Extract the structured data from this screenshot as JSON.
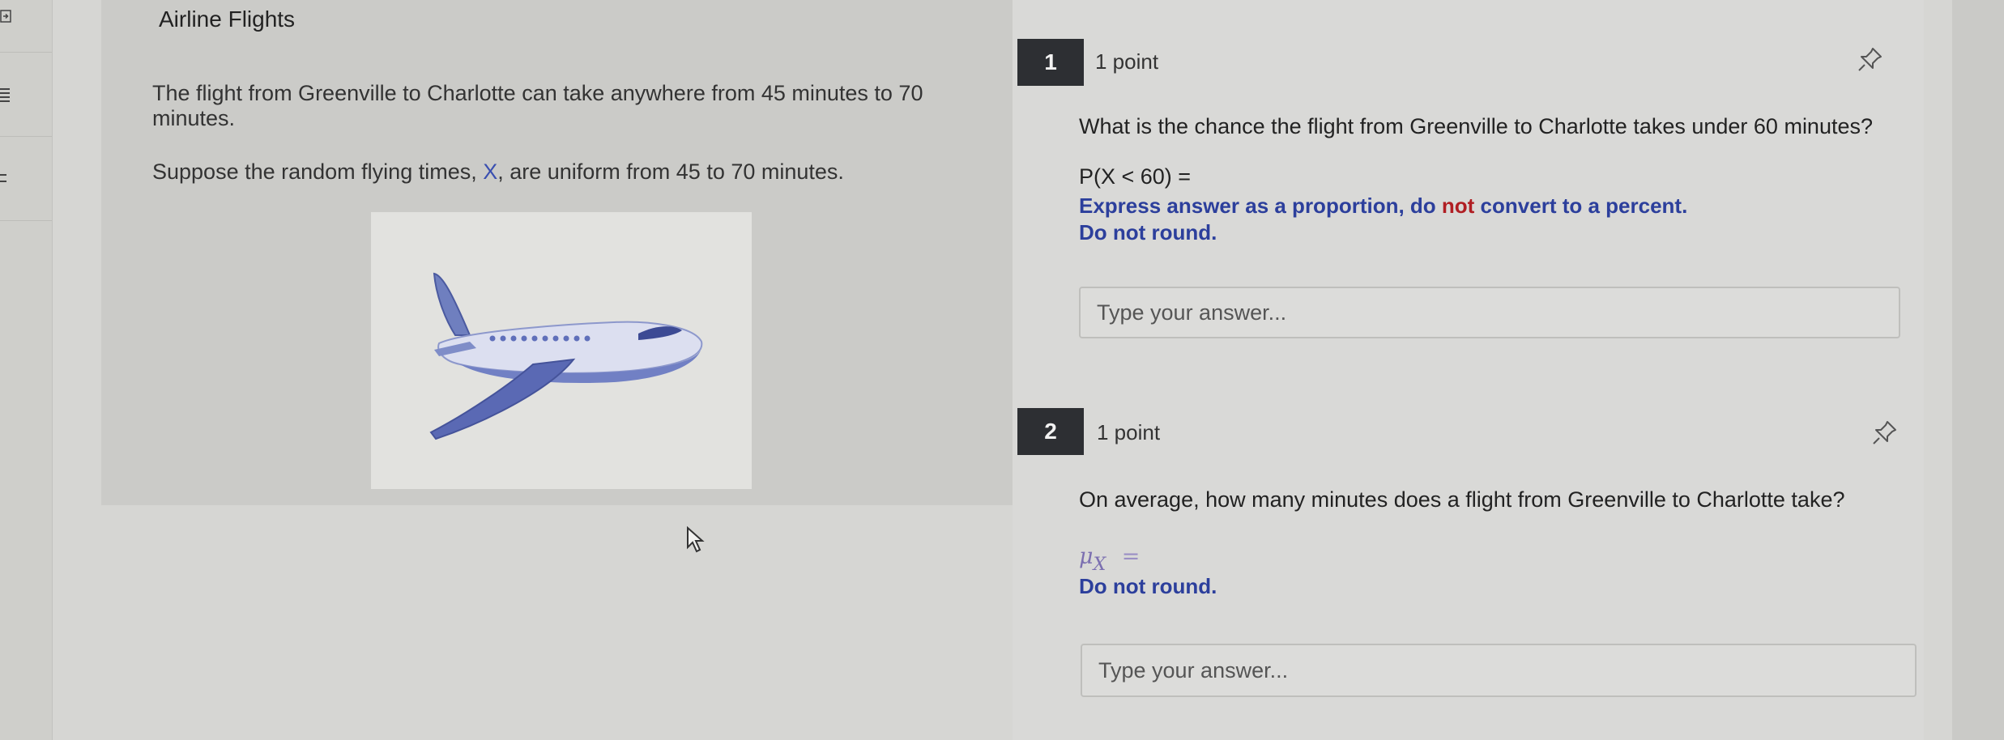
{
  "title": "Airline Flights",
  "intro": {
    "line1": "The flight from Greenville to Charlotte can take anywhere from 45 minutes to 70",
    "line2": "minutes.",
    "para2_before": "Suppose the random flying times, ",
    "para2_var": "X",
    "para2_after": ", are uniform from 45 to 70 minutes."
  },
  "questions": [
    {
      "number": "1",
      "points": "1 point",
      "prompt": "What is the chance the flight from Greenville to Charlotte takes under 60 minutes?",
      "math": "P(X < 60) =",
      "instr_line1_a": "Express answer as a proportion, do ",
      "instr_line1_not": "not",
      "instr_line1_b": " convert to a percent.",
      "instr_line2": "Do not round.",
      "placeholder": "Type your answer..."
    },
    {
      "number": "2",
      "points": "1 point",
      "prompt": "On average, how many minutes does a flight from Greenville to Charlotte take?",
      "math_mu": "μ",
      "math_sub": "X",
      "math_eq": "=",
      "instr": "Do not round.",
      "placeholder": "Type your answer..."
    }
  ],
  "colors": {
    "accent_blue": "#2c3f9c",
    "accent_red": "#b01e23",
    "badge_bg": "#2d2f33"
  },
  "icons": [
    "sidebar-collapse-icon",
    "list-icon",
    "pin-icon",
    "airplane-illustration",
    "mouse-pointer-icon"
  ]
}
